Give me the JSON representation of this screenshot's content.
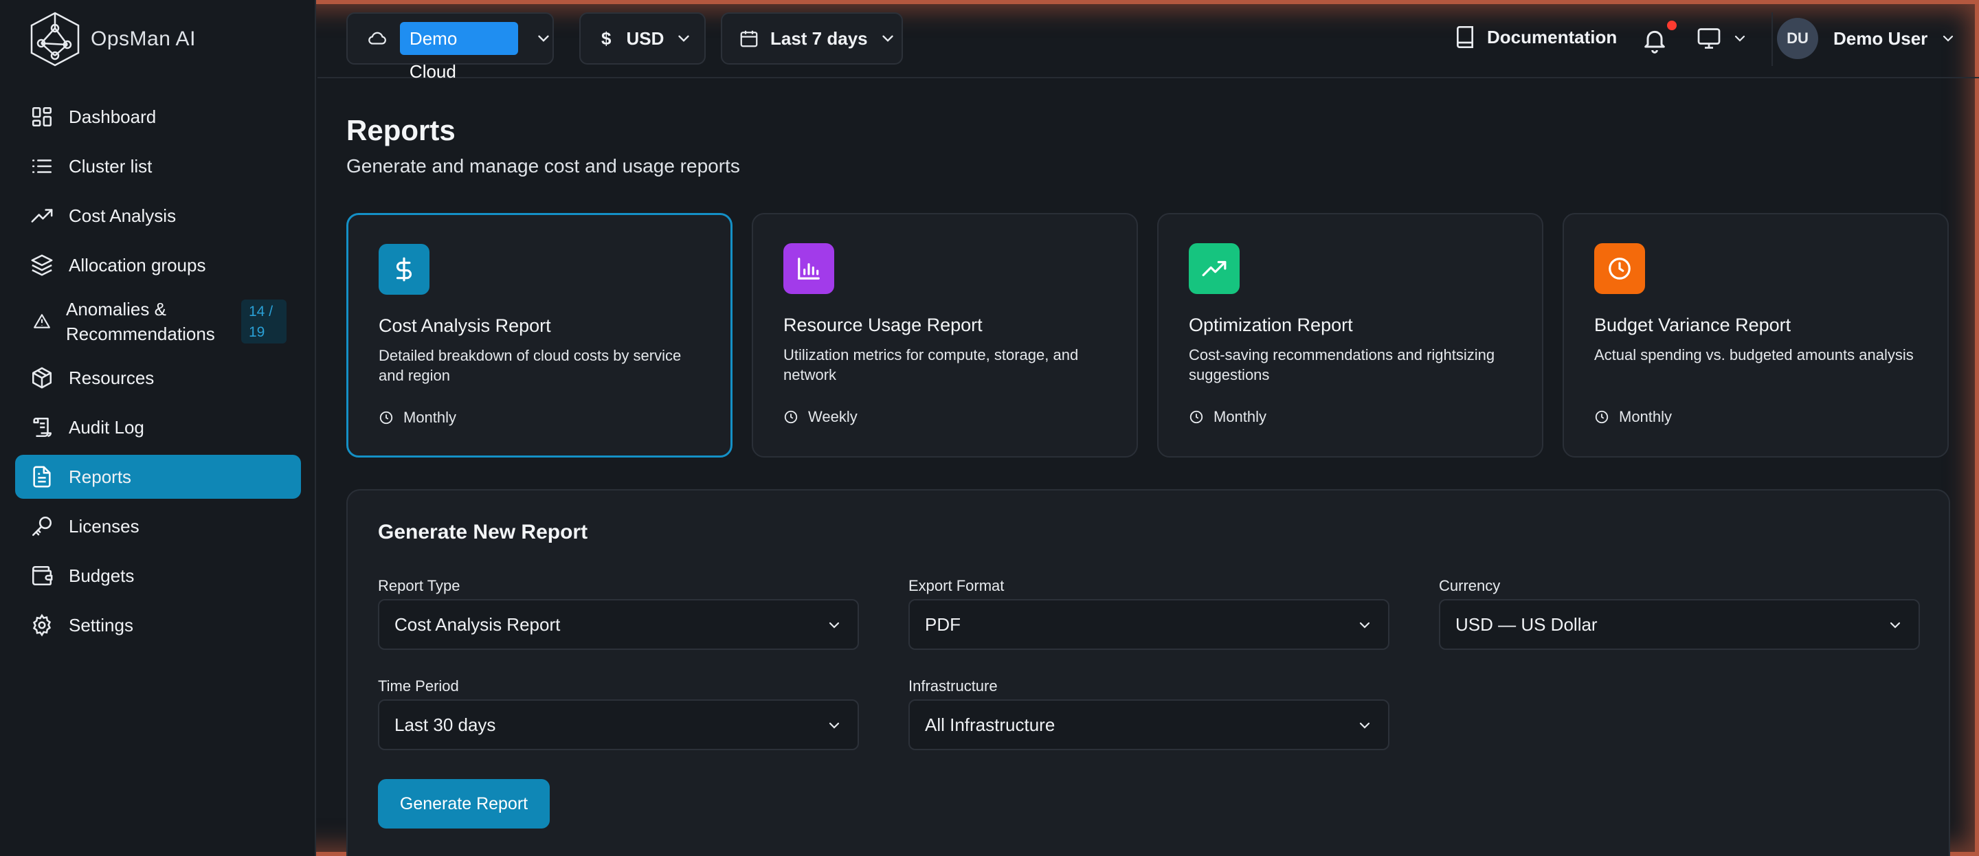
{
  "app": {
    "name": "OpsMan AI"
  },
  "sidebar": {
    "items": [
      {
        "label": "Dashboard",
        "icon": "dashboard-grid-icon"
      },
      {
        "label": "Cluster list",
        "icon": "list-icon"
      },
      {
        "label": "Cost Analysis",
        "icon": "trending-up-icon"
      },
      {
        "label": "Allocation groups",
        "icon": "layers-icon"
      },
      {
        "label": "Anomalies & Recommendations",
        "icon": "warning-triangle-icon",
        "badge": "14 / 19"
      },
      {
        "label": "Resources",
        "icon": "package-icon"
      },
      {
        "label": "Audit Log",
        "icon": "scroll-icon"
      },
      {
        "label": "Reports",
        "icon": "file-text-icon",
        "active": true
      },
      {
        "label": "Licenses",
        "icon": "key-icon"
      },
      {
        "label": "Budgets",
        "icon": "wallet-icon"
      },
      {
        "label": "Settings",
        "icon": "gear-icon"
      }
    ]
  },
  "topbar": {
    "cloud_label": "Demo Cloud",
    "currency_symbol": "$",
    "currency": "USD",
    "date_range": "Last 7 days",
    "documentation": "Documentation",
    "user_initials": "DU",
    "user_name": "Demo User"
  },
  "page": {
    "title": "Reports",
    "subtitle": "Generate and manage cost and usage reports"
  },
  "report_cards": [
    {
      "title": "Cost Analysis Report",
      "description": "Detailed breakdown of cloud costs by service and region",
      "frequency": "Monthly",
      "icon": "dollar-icon",
      "color": "#0e87b5"
    },
    {
      "title": "Resource Usage Report",
      "description": "Utilization metrics for compute, storage, and network",
      "frequency": "Weekly",
      "icon": "bar-chart-icon",
      "color": "#a23bea"
    },
    {
      "title": "Optimization Report",
      "description": "Cost-saving recommendations and rightsizing suggestions",
      "frequency": "Monthly",
      "icon": "trending-up-icon",
      "color": "#16c47f"
    },
    {
      "title": "Budget Variance Report",
      "description": "Actual spending vs. budgeted amounts analysis",
      "frequency": "Monthly",
      "icon": "clock-icon",
      "color": "#f46a0b"
    }
  ],
  "generate": {
    "title": "Generate New Report",
    "report_type_label": "Report Type",
    "report_type_value": "Cost Analysis Report",
    "export_format_label": "Export Format",
    "export_format_value": "PDF",
    "currency_label": "Currency",
    "currency_value": "USD — US Dollar",
    "time_period_label": "Time Period",
    "time_period_value": "Last 30 days",
    "infrastructure_label": "Infrastructure",
    "infrastructure_value": "All Infrastructure",
    "button_label": "Generate Report"
  }
}
